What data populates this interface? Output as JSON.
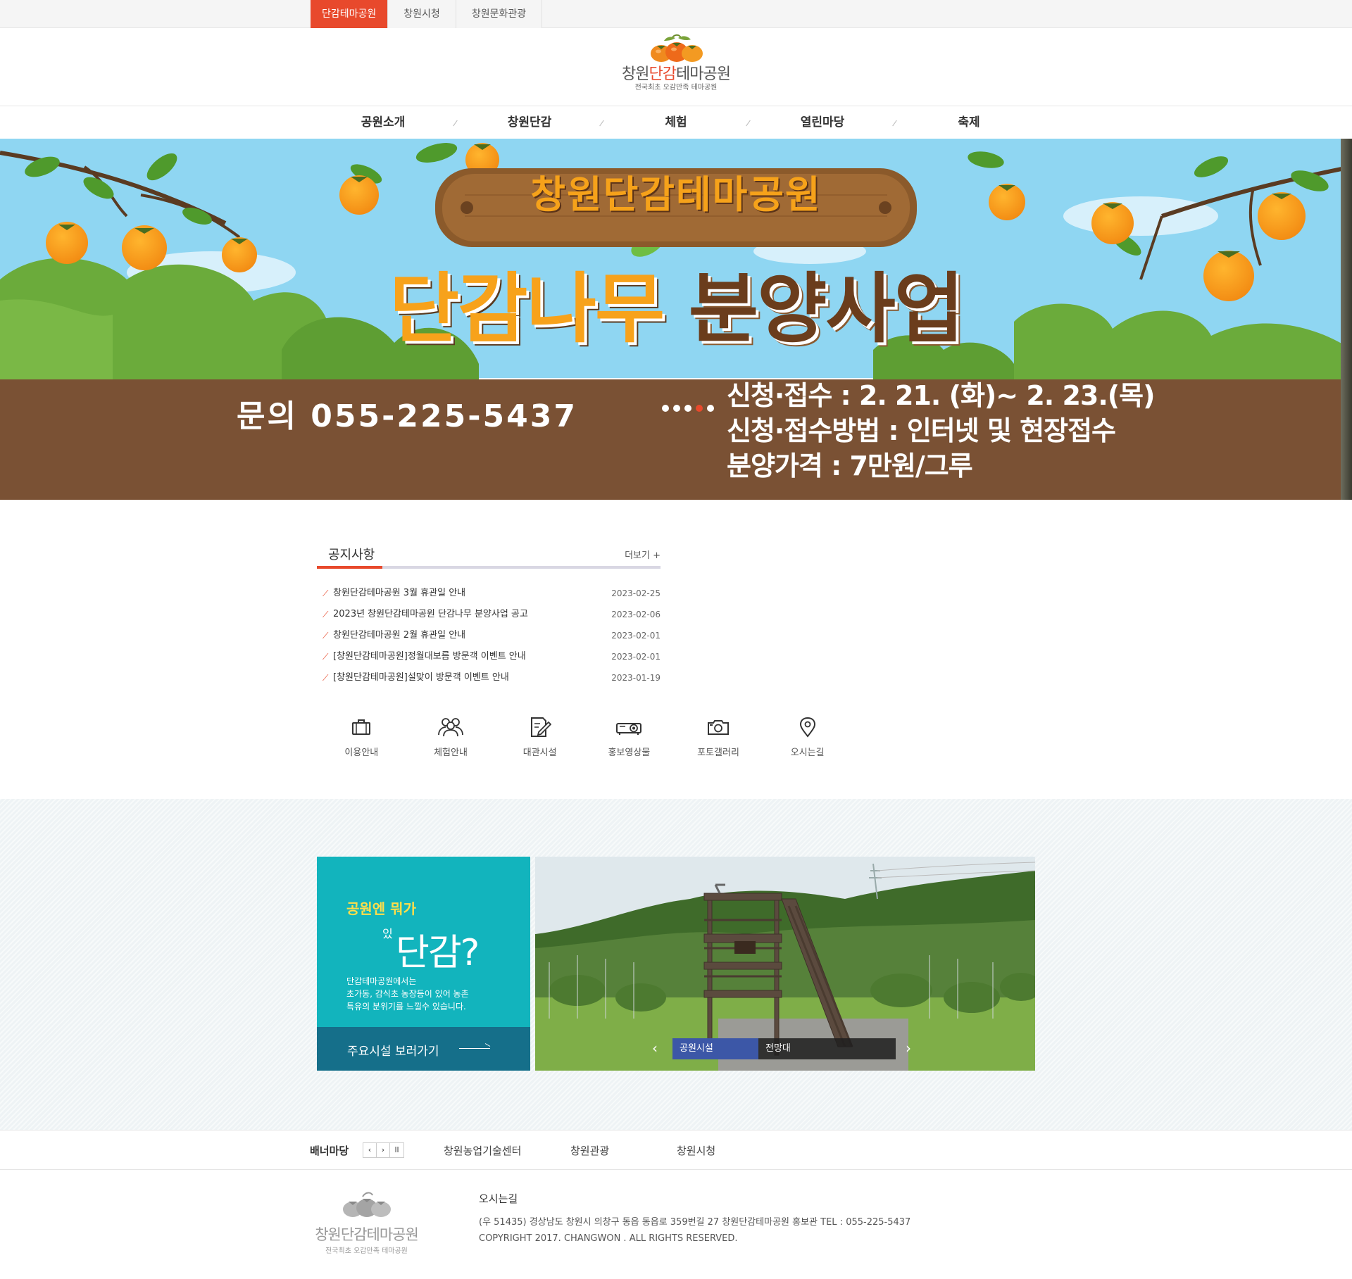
{
  "top_tabs": [
    "단감테마공원",
    "창원시청",
    "창원문화관광"
  ],
  "logo": {
    "name_pre": "창원",
    "name_accent": "단감",
    "name_post": "테마공원",
    "tagline": "전국최초 오감만족 테마공원"
  },
  "gnb": [
    "공원소개",
    "창원단감",
    "체험",
    "열린마당",
    "축제"
  ],
  "hero": {
    "sign": "창원단감테마공원",
    "title_a": "단감나무",
    "title_b": "분양사업",
    "contact": "문의 055-225-5437",
    "info": [
      "신청·접수 : 2. 21. (화)~ 2. 23.(목)",
      "신청·접수방법 : 인터넷 및 현장접수",
      "분양가격 : 7만원/그루"
    ]
  },
  "notice": {
    "title": "공지사항",
    "more": "더보기 +",
    "items": [
      {
        "title": "창원단감테마공원 3월 휴관일 안내",
        "date": "2023-02-25"
      },
      {
        "title": "2023년 창원단감테마공원 단감나무 분양사업 공고",
        "date": "2023-02-06"
      },
      {
        "title": "창원단감테마공원 2월 휴관일 안내",
        "date": "2023-02-01"
      },
      {
        "title": "[창원단감테마공원]정월대보름 방문객 이벤트 안내",
        "date": "2023-02-01"
      },
      {
        "title": "[창원단감테마공원]설맞이 방문객 이벤트 안내",
        "date": "2023-01-19"
      }
    ]
  },
  "quick": [
    {
      "label": "이용안내",
      "icon": "briefcase-icon"
    },
    {
      "label": "체험안내",
      "icon": "people-icon"
    },
    {
      "label": "대관시설",
      "icon": "document-pen-icon"
    },
    {
      "label": "홍보영상물",
      "icon": "projector-icon"
    },
    {
      "label": "포토갤러리",
      "icon": "camera-icon"
    },
    {
      "label": "오시는길",
      "icon": "map-pin-icon"
    }
  ],
  "park": {
    "q1": "공원엔 뭐가",
    "q2_small": "있",
    "q2_big": "단감?",
    "desc": [
      "단감테마공원에서는",
      "초가동, 감식초 농장등이 있어 농촌",
      "특유의 분위기를 느낄수 있습니다."
    ],
    "go": "주요시설 보러가기",
    "caption_category": "공원시설",
    "caption_name": "전망대"
  },
  "bannerzone": {
    "title": "배너마당",
    "ctrl_prev": "‹",
    "ctrl_next": "›",
    "ctrl_pause": "ll",
    "links": [
      "창원농업기술센터",
      "창원관광",
      "창원시청"
    ]
  },
  "footer": {
    "logo_name": "창원단감테마공원",
    "logo_sub": "전국최초 오감만족 테마공원",
    "heading": "오시는길",
    "address": "(우 51435) 경상남도 창원시 의창구 동읍 동읍로 359번길 27   창원단감테마공원 홍보관    TEL : 055-225-5437",
    "copyright": "COPYRIGHT 2017. CHANGWON . ALL RIGHTS RESERVED."
  },
  "colors": {
    "accent": "#e8492c",
    "teal": "#12b4bd",
    "navy_teal": "#156f8a",
    "soil": "#7a5134",
    "sky": "#8fd6f2",
    "grass": "#6bab3b"
  }
}
